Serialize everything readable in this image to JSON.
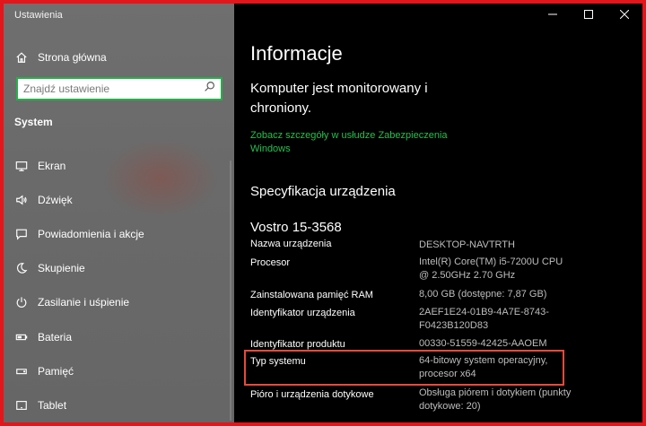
{
  "window": {
    "title": "Ustawienia"
  },
  "sidebar": {
    "home_label": "Strona główna",
    "search_placeholder": "Znajdź ustawienie",
    "section_title": "System",
    "items": [
      {
        "label": "Ekran",
        "icon": "display-icon"
      },
      {
        "label": "Dźwięk",
        "icon": "speaker-icon"
      },
      {
        "label": "Powiadomienia i akcje",
        "icon": "notification-icon"
      },
      {
        "label": "Skupienie",
        "icon": "moon-icon"
      },
      {
        "label": "Zasilanie i uśpienie",
        "icon": "power-icon"
      },
      {
        "label": "Bateria",
        "icon": "battery-icon"
      },
      {
        "label": "Pamięć",
        "icon": "storage-icon"
      },
      {
        "label": "Tablet",
        "icon": "tablet-icon"
      }
    ]
  },
  "main": {
    "title": "Informacje",
    "protection_text": "Komputer jest monitorowany i chroniony.",
    "security_link": "Zobacz szczegóły w usłudze Zabezpieczenia Windows",
    "spec_heading": "Specyfikacja urządzenia",
    "device_name": "Vostro 15-3568",
    "specs": [
      {
        "label": "Nazwa urządzenia",
        "value": "DESKTOP-NAVTRTH"
      },
      {
        "label": "Procesor",
        "value": "Intel(R) Core(TM) i5-7200U CPU @ 2.50GHz   2.70 GHz"
      },
      {
        "label": "Zainstalowana pamięć RAM",
        "value": "8,00 GB (dostępne: 7,87 GB)"
      },
      {
        "label": "Identyfikator urządzenia",
        "value": "2AEF1E24-01B9-4A7E-8743-F0423B120D83"
      },
      {
        "label": "Identyfikator produktu",
        "value": "00330-51559-42425-AAOEM"
      },
      {
        "label": "Typ systemu",
        "value": "64-bitowy system operacyjny, procesor x64"
      },
      {
        "label": "Pióro i urządzenia dotykowe",
        "value": "Obsługa piórem i dotykiem (punkty dotykowe: 20)"
      }
    ]
  },
  "colors": {
    "accent_green": "#27c04f",
    "highlight_red": "#e84a3a",
    "frame_red": "#e3161b"
  }
}
